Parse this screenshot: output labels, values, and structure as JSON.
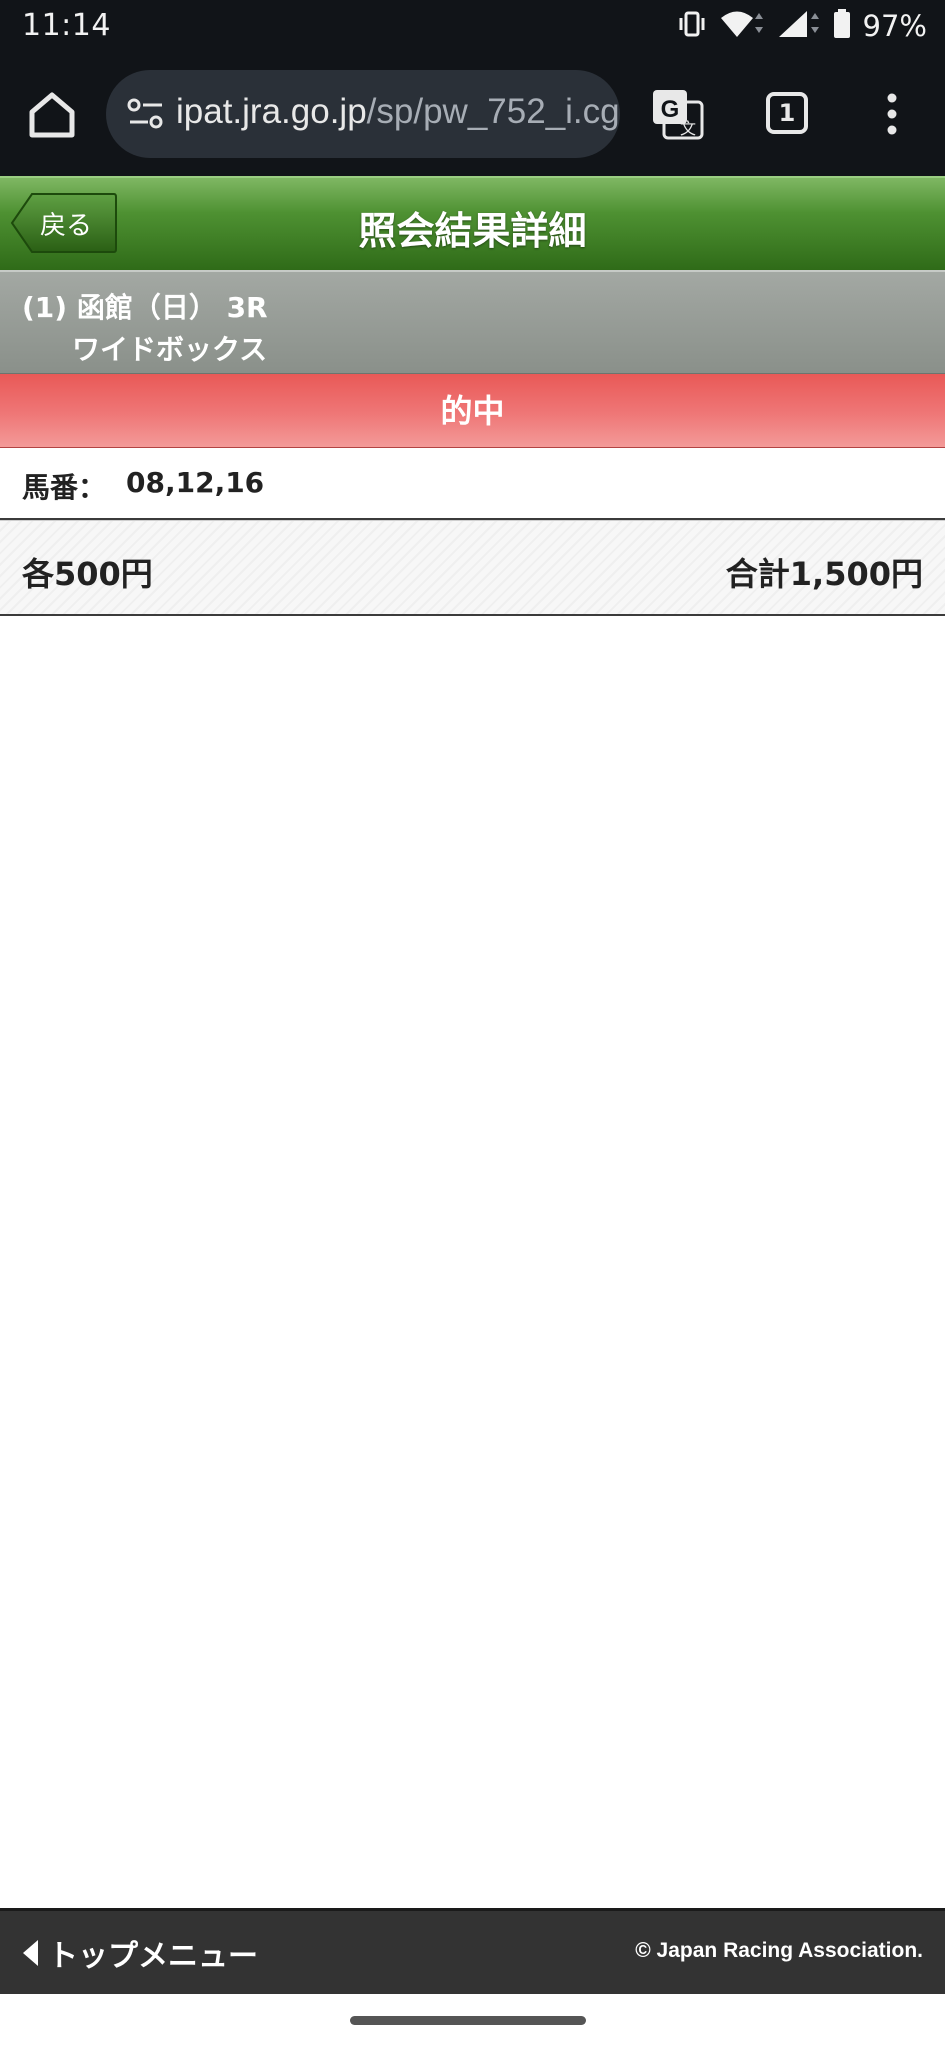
{
  "status_bar": {
    "time": "11:14",
    "battery_percent": "97%",
    "icons": [
      "vibrate-icon",
      "wifi-icon",
      "cellular-signal-icon",
      "battery-icon"
    ]
  },
  "browser": {
    "url_host": "ipat.jra.go.jp",
    "url_path": "/sp/pw_752_i.cg",
    "tab_count": "1",
    "icons": [
      "home-icon",
      "site-info-icon",
      "translate-icon",
      "more-vert-icon"
    ]
  },
  "header": {
    "back_label": "戻る",
    "title": "照会結果詳細",
    "color": "#3d7d22"
  },
  "race": {
    "line": "(1) 函館（日） 3R",
    "bet_type": "ワイドボックス"
  },
  "result": {
    "label": "的中",
    "color": "#ec6a69"
  },
  "selection": {
    "label": "馬番：",
    "numbers": "08,12,16"
  },
  "amount": {
    "each": "各500円",
    "total": "合計1,500円"
  },
  "footer": {
    "menu_label": "トップメニュー",
    "copyright": "© Japan Racing Association."
  }
}
